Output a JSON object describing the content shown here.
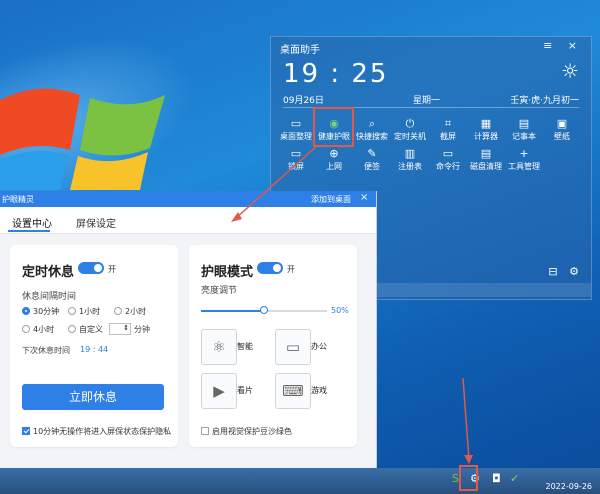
{
  "widget": {
    "title": "桌面助手",
    "clock": "19 : 25",
    "date": "09月26日",
    "weekday": "星期一",
    "lunar": "壬寅·虎·九月初一",
    "tools": [
      {
        "label": "桌面整理",
        "icon": "monitor-icon"
      },
      {
        "label": "健康护眼",
        "icon": "eye-icon"
      },
      {
        "label": "快捷搜索",
        "icon": "search-icon"
      },
      {
        "label": "定时关机",
        "icon": "power-icon"
      },
      {
        "label": "截屏",
        "icon": "crop-icon"
      },
      {
        "label": "计算器",
        "icon": "calculator-icon"
      },
      {
        "label": "记事本",
        "icon": "notepad-icon"
      },
      {
        "label": "壁纸",
        "icon": "image-icon"
      },
      {
        "label": "锁屏",
        "icon": "lock-icon"
      },
      {
        "label": "上网",
        "icon": "globe-icon"
      },
      {
        "label": "便签",
        "icon": "note-icon"
      },
      {
        "label": "注册表",
        "icon": "registry-icon"
      },
      {
        "label": "命令行",
        "icon": "terminal-icon"
      },
      {
        "label": "磁盘清理",
        "icon": "disk-icon"
      },
      {
        "label": "工具管理",
        "icon": "plus-icon"
      }
    ]
  },
  "dialog": {
    "title": "护眼精灵",
    "add_desktop": "添加到桌面",
    "tabs": [
      "设置中心",
      "屏保设定"
    ],
    "rest": {
      "heading": "定时休息",
      "toggle_label": "开",
      "interval_label": "休息间隔时间",
      "options": [
        "30分钟",
        "1小时",
        "2小时",
        "4小时",
        "自定义"
      ],
      "selected": "30分钟",
      "custom_unit": "分钟",
      "next_label": "下次休息时间",
      "next_time": "19 : 44",
      "button": "立即休息",
      "checkbox": "10分钟无操作将进入屏保状态保护隐私"
    },
    "eye": {
      "heading": "护眼模式",
      "toggle_label": "开",
      "brightness_label": "亮度调节",
      "brightness_value": "50%",
      "brightness": 0.5,
      "modes": [
        {
          "label": "智能",
          "icon": "atom-icon"
        },
        {
          "label": "办公",
          "icon": "monitor-icon"
        },
        {
          "label": "看片",
          "icon": "film-icon"
        },
        {
          "label": "游戏",
          "icon": "gamepad-icon"
        }
      ],
      "checkbox": "启用视觉保护豆沙绿色"
    }
  },
  "taskbar": {
    "date": "2022-09-26"
  },
  "colors": {
    "accent": "#2e7fe6",
    "highlight": "#e05a47"
  }
}
